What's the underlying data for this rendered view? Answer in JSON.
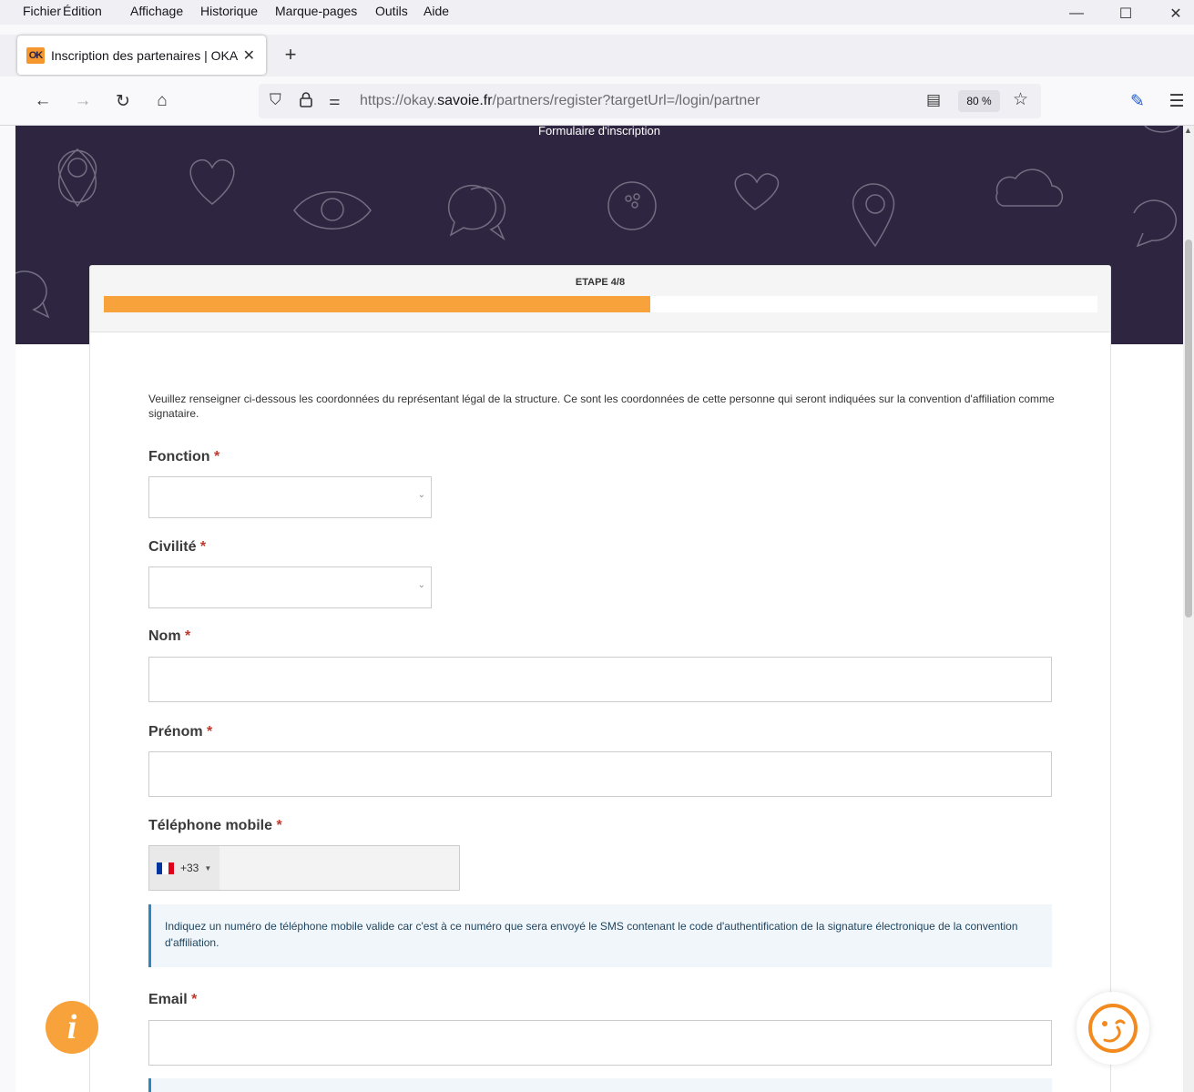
{
  "browser": {
    "menu": [
      {
        "label": "Fichier"
      },
      {
        "label": "Édition"
      },
      {
        "label": "Affichage"
      },
      {
        "label": "Historique"
      },
      {
        "label": "Marque-pages"
      },
      {
        "label": "Outils"
      },
      {
        "label": "Aide"
      }
    ],
    "window_controls": {
      "minimize": "—",
      "maximize": "☐",
      "close": "✕"
    },
    "tab": {
      "title": "Inscription des partenaires | OKAY",
      "favicon_text": "OK",
      "close_glyph": "✕"
    },
    "new_tab_glyph": "+",
    "url": {
      "prefix": "https://okay.",
      "domain": "savoie.fr",
      "path": "/partners/register?targetUrl=/login/partner"
    },
    "zoom": "80 %",
    "icons": {
      "back": "←",
      "forward": "→",
      "reload": "↻",
      "home": "⌂",
      "shield": "⛉",
      "lock": "🔒",
      "permissions": "⚌",
      "reader": "▤",
      "bookmark": "☆",
      "extension": "✎",
      "menu": "☰"
    }
  },
  "page": {
    "banner_title": "Formulaire d'inscription",
    "step": {
      "label": "ETAPE 4/8",
      "progress": 0.55
    },
    "intro": "Veuillez renseigner ci-dessous les coordonnées du représentant légal de la structure. Ce sont les coordonnées de cette personne qui seront indiquées sur la convention d'affiliation comme signataire.",
    "required_mark": "*",
    "fields": {
      "fonction": {
        "label": "Fonction",
        "value": ""
      },
      "civilite": {
        "label": "Civilité",
        "value": ""
      },
      "nom": {
        "label": "Nom",
        "value": ""
      },
      "prenom": {
        "label": "Prénom",
        "value": ""
      },
      "telephone": {
        "label": "Téléphone mobile",
        "dial_code": "+33",
        "value": ""
      },
      "email": {
        "label": "Email",
        "value": ""
      }
    },
    "phone_hint": "Indiquez un numéro de téléphone mobile valide car c'est à ce numéro que sera envoyé le SMS contenant le code d'authentification de la signature électronique de la convention d'affiliation.",
    "info_button_glyph": "i",
    "colors": {
      "banner": "#2e2640",
      "accent": "#f7a23a",
      "required": "#c0392b",
      "hint_border": "#2f86c3"
    }
  }
}
